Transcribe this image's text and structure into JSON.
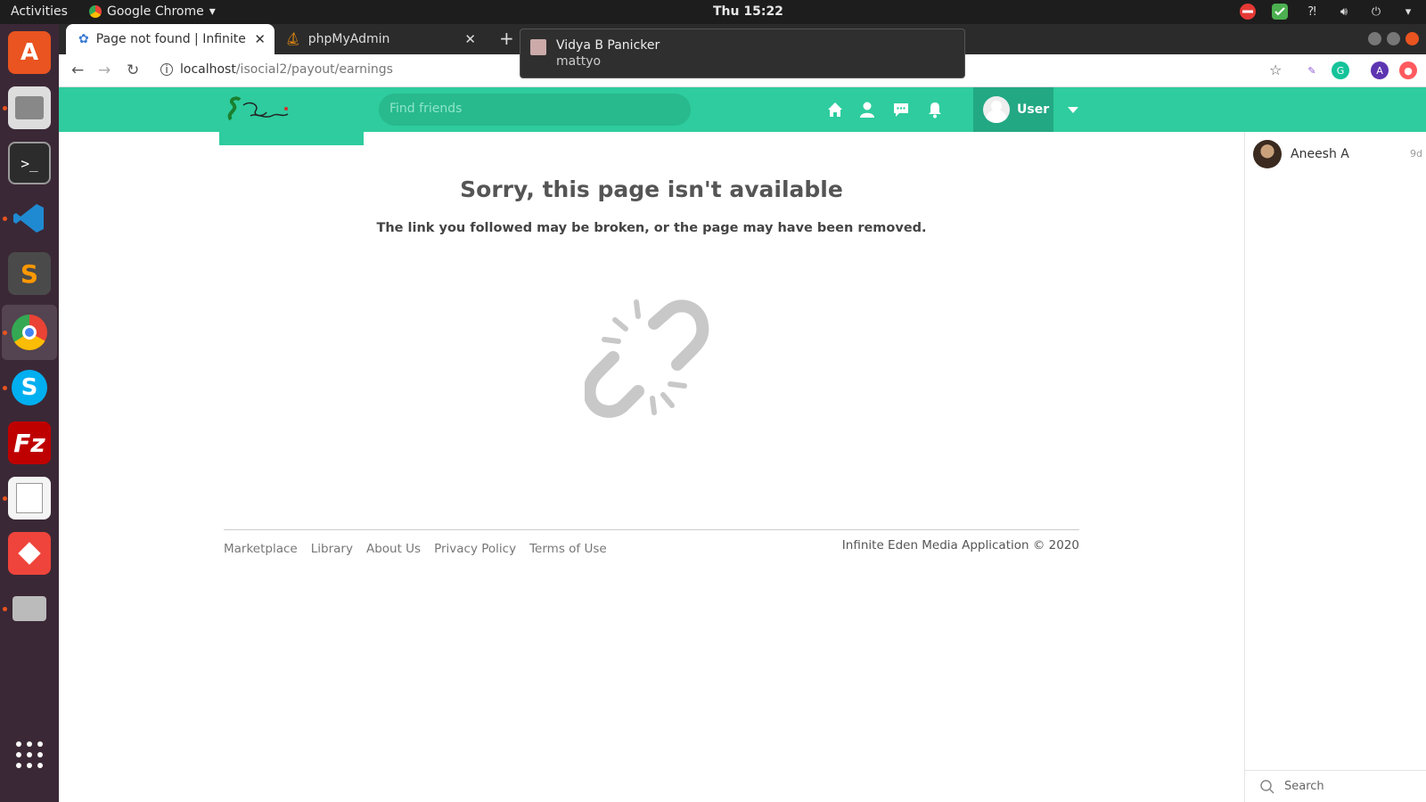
{
  "system": {
    "activities": "Activities",
    "app_name": "Google Chrome",
    "clock": "Thu 15:22"
  },
  "browser": {
    "tabs": [
      {
        "title": "Page not found | Infinite E",
        "active": true
      },
      {
        "title": "phpMyAdmin",
        "active": false
      }
    ],
    "url_host": "localhost",
    "url_path": "/isocial2/payout/earnings",
    "extension_letter": "A"
  },
  "notification": {
    "title": "Vidya B Panicker",
    "body": "mattyo"
  },
  "site": {
    "search_placeholder": "Find friends",
    "user_label": "User",
    "brand_color": "#2ecc9e"
  },
  "error": {
    "title": "Sorry, this page isn't available",
    "message": "The link you followed may be broken, or the page may have been removed."
  },
  "footer": {
    "links": [
      "Marketplace",
      "Library",
      "About Us",
      "Privacy Policy",
      "Terms of Use"
    ],
    "copyright": "Infinite Eden Media Application © 2020"
  },
  "chat": {
    "contacts": [
      {
        "name": "Aneesh A",
        "time": "9d"
      }
    ],
    "search_label": "Search"
  },
  "dock": {
    "apps": [
      "ubuntu-software-icon",
      "files-icon",
      "terminal-icon",
      "vscode-icon",
      "sublime-icon",
      "chrome-icon",
      "skype-icon",
      "filezilla-icon",
      "text-editor-icon",
      "anydesk-icon",
      "printer-icon",
      "show-apps-icon"
    ]
  }
}
